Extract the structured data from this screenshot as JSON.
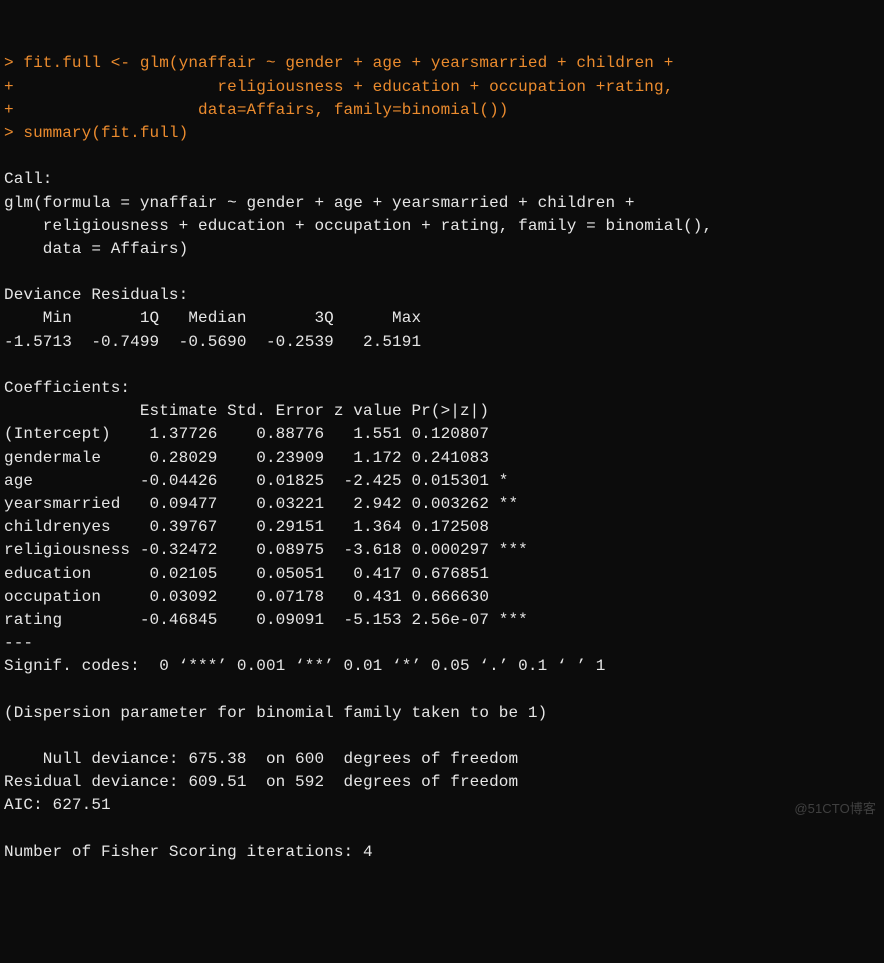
{
  "input": {
    "line1_prompt": "> ",
    "line1_cmd": "fit.full <- glm(ynaffair ~ gender + age + yearsmarried + children +",
    "line2_prompt": "+ ",
    "line2_cmd": "                    religiousness + education + occupation +rating,",
    "line3_prompt": "+ ",
    "line3_cmd": "                  data=Affairs, family=binomial())",
    "line4_prompt": "> ",
    "line4_cmd": "summary(fit.full)"
  },
  "call": {
    "header": "Call:",
    "l1": "glm(formula = ynaffair ~ gender + age + yearsmarried + children + ",
    "l2": "    religiousness + education + occupation + rating, family = binomial(), ",
    "l3": "    data = Affairs)"
  },
  "devres": {
    "header": "Deviance Residuals: ",
    "labels": "    Min       1Q   Median       3Q      Max  ",
    "values": "-1.5713  -0.7499  -0.5690  -0.2539   2.5191  "
  },
  "coef": {
    "header": "Coefficients:",
    "colhead": "              Estimate Std. Error z value Pr(>|z|)    ",
    "rows": {
      "intercept": "(Intercept)    1.37726    0.88776   1.551 0.120807    ",
      "gendermale": "gendermale     0.28029    0.23909   1.172 0.241083    ",
      "age": "age           -0.04426    0.01825  -2.425 0.015301 *  ",
      "yearsmarried": "yearsmarried   0.09477    0.03221   2.942 0.003262 ** ",
      "childrenyes": "childrenyes    0.39767    0.29151   1.364 0.172508    ",
      "religiousness": "religiousness -0.32472    0.08975  -3.618 0.000297 ***",
      "education": "education      0.02105    0.05051   0.417 0.676851    ",
      "occupation": "occupation     0.03092    0.07178   0.431 0.666630    ",
      "rating": "rating        -0.46845    0.09091  -5.153 2.56e-07 ***"
    },
    "sep": "---",
    "signif": "Signif. codes:  0 ‘***’ 0.001 ‘**’ 0.01 ‘*’ 0.05 ‘.’ 0.1 ‘ ’ 1"
  },
  "disp": "(Dispersion parameter for binomial family taken to be 1)",
  "dev": {
    "null": "    Null deviance: 675.38  on 600  degrees of freedom",
    "resid": "Residual deviance: 609.51  on 592  degrees of freedom",
    "aic": "AIC: 627.51"
  },
  "fisher": "Number of Fisher Scoring iterations: 4",
  "watermark": "@51CTO博客"
}
